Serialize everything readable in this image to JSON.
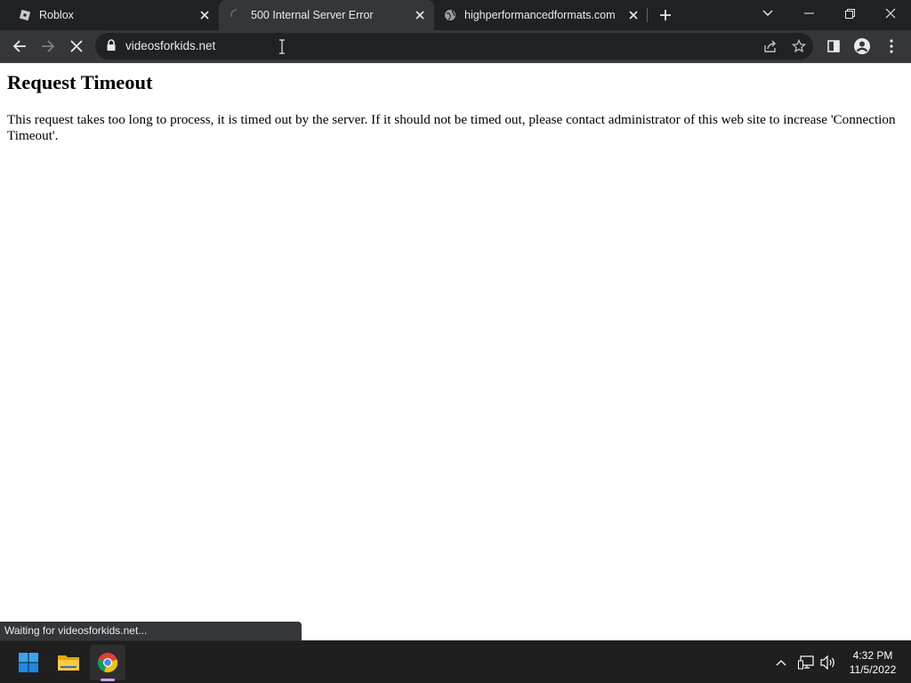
{
  "tabs": [
    {
      "title": "Roblox",
      "icon": "roblox-icon"
    },
    {
      "title": "500 Internal Server Error",
      "icon": "loading-spinner-icon",
      "active": true
    },
    {
      "title": "highperformancedformats.com",
      "icon": "globe-icon"
    }
  ],
  "address_bar": {
    "url": "videosforkids.net"
  },
  "page": {
    "heading": "Request Timeout",
    "message": "This request takes too long to process, it is timed out by the server. If it should not be timed out, please contact administrator of this web site to increase 'Connection Timeout'."
  },
  "status_bar": {
    "text": "Waiting for videosforkids.net..."
  },
  "taskbar": {
    "apps": [
      "windows-start-icon",
      "file-explorer-icon",
      "chrome-icon"
    ],
    "clock": {
      "time": "4:32 PM",
      "date": "11/5/2022"
    }
  },
  "colors": {
    "tabstrip_bg": "#202124",
    "toolbar_bg": "#35363a",
    "omnibox_bg": "#202124",
    "taskbar_bg": "#1f1f1f",
    "windows_blue": "#0078d4"
  }
}
